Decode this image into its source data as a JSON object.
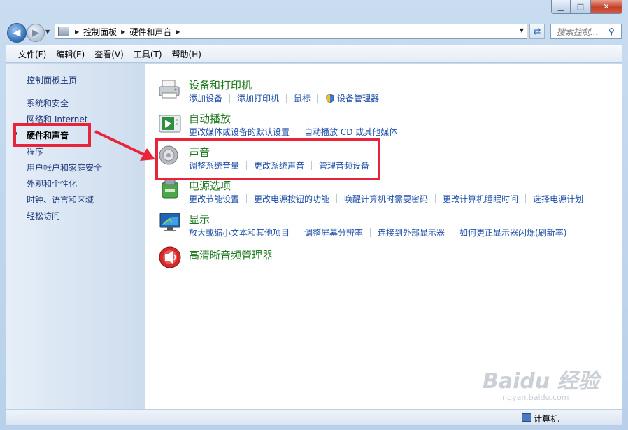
{
  "window": {
    "minimize_glyph": "▁",
    "maximize_glyph": "□",
    "close_glyph": "✕"
  },
  "address_bar": {
    "crumbs": [
      "控制面板",
      "硬件和声音"
    ],
    "search_placeholder": "搜索控制..."
  },
  "menu": {
    "items": [
      "文件(F)",
      "编辑(E)",
      "查看(V)",
      "工具(T)",
      "帮助(H)"
    ]
  },
  "sidebar": {
    "home": "控制面板主页",
    "items": [
      "系统和安全",
      "网络和 Internet",
      "硬件和声音",
      "程序",
      "用户帐户和家庭安全",
      "外观和个性化",
      "时钟、语言和区域",
      "轻松访问"
    ],
    "current_index": 2
  },
  "categories": [
    {
      "title": "设备和打印机",
      "icon": "printer-icon",
      "links": [
        "添加设备",
        "添加打印机",
        "鼠标",
        "设备管理器"
      ]
    },
    {
      "title": "自动播放",
      "icon": "autoplay-icon",
      "links": [
        "更改媒体或设备的默认设置",
        "自动播放 CD 或其他媒体"
      ]
    },
    {
      "title": "声音",
      "icon": "speaker-icon",
      "links": [
        "调整系统音量",
        "更改系统声音",
        "管理音频设备"
      ]
    },
    {
      "title": "电源选项",
      "icon": "power-icon",
      "links": [
        "更改节能设置",
        "更改电源按钮的功能",
        "唤醒计算机时需要密码",
        "更改计算机睡眠时间",
        "选择电源计划"
      ]
    },
    {
      "title": "显示",
      "icon": "display-icon",
      "links": [
        "放大或缩小文本和其他项目",
        "调整屏幕分辨率",
        "连接到外部显示器",
        "如何更正显示器闪烁(刷新率)"
      ]
    },
    {
      "title": "高清晰音频管理器",
      "icon": "audio-manager-icon",
      "links": []
    }
  ],
  "status_bar": {
    "text": "计算机"
  },
  "annotation": {
    "color": "#e8243a"
  },
  "watermark": {
    "brand": "Baidu 经验",
    "url": "jingyan.baidu.com"
  }
}
